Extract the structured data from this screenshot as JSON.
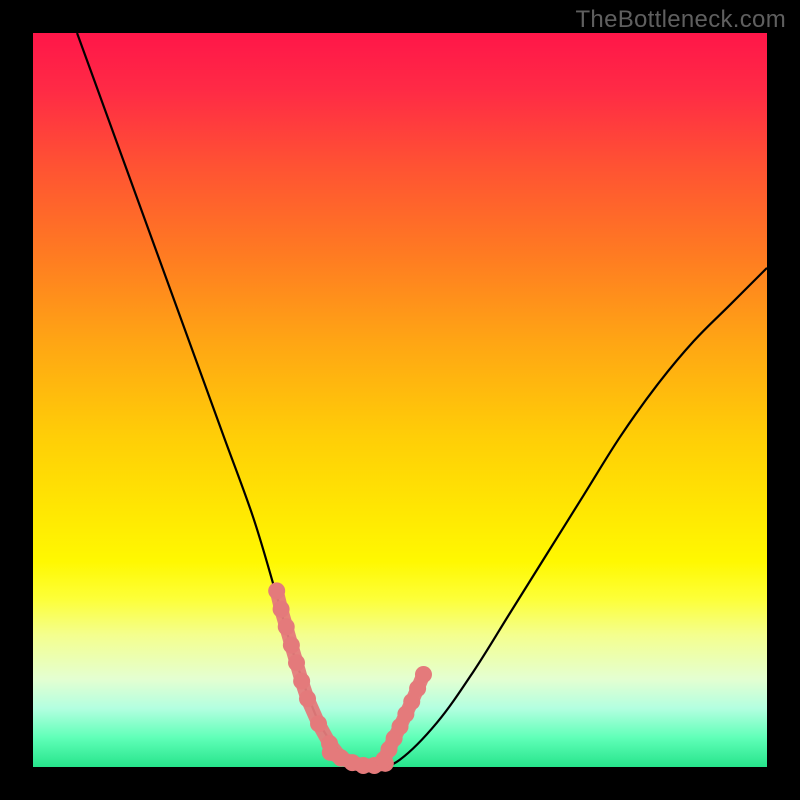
{
  "watermark": "TheBottleneck.com",
  "chart_data": {
    "type": "line",
    "title": "",
    "xlabel": "",
    "ylabel": "",
    "xlim": [
      0,
      100
    ],
    "ylim": [
      0,
      100
    ],
    "series": [
      {
        "name": "bottleneck-curve",
        "x": [
          6,
          10,
          14,
          18,
          22,
          26,
          30,
          33,
          35,
          37,
          39,
          41,
          43,
          45,
          47,
          50,
          55,
          60,
          65,
          70,
          75,
          80,
          85,
          90,
          95,
          100
        ],
        "y": [
          100,
          89,
          78,
          67,
          56,
          45,
          34,
          24,
          17,
          11,
          6,
          3,
          1,
          0,
          0,
          1,
          6,
          13,
          21,
          29,
          37,
          45,
          52,
          58,
          63,
          68
        ],
        "color": "#000000"
      },
      {
        "name": "highlight-left",
        "x": [
          33.2,
          33.8,
          34.5,
          35.2,
          35.9,
          36.6,
          37.4,
          38.9,
          40.4,
          41.9
        ],
        "y": [
          24.0,
          21.5,
          19.1,
          16.6,
          14.2,
          11.7,
          9.3,
          5.9,
          3.2,
          1.3
        ],
        "color": "#e47a7b"
      },
      {
        "name": "highlight-bottom",
        "x": [
          40.5,
          42.0,
          43.5,
          45.0,
          46.5,
          48.0
        ],
        "y": [
          2.0,
          1.2,
          0.6,
          0.2,
          0.2,
          0.5
        ],
        "color": "#e47a7b"
      },
      {
        "name": "highlight-right",
        "x": [
          47.8,
          48.5,
          49.2,
          50.0,
          50.8,
          51.6,
          52.4,
          53.2
        ],
        "y": [
          1.0,
          2.4,
          3.9,
          5.5,
          7.2,
          8.9,
          10.7,
          12.6
        ],
        "color": "#e47a7b"
      }
    ]
  }
}
